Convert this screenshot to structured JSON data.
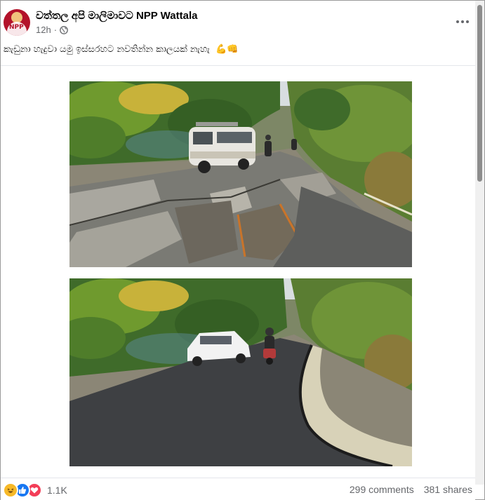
{
  "post": {
    "page_name": "වත්තල අපි මාලිමාවට NPP Wattala",
    "time": "12h",
    "separator": "·",
    "audience_icon": "globe-icon",
    "caption": "කැඩුනා හැදුවා යමු ඉස්සරහට නවතින්න කාලයක් නැහැ",
    "caption_emojis": "💪👊"
  },
  "avatar": {
    "mark": "NPP"
  },
  "photos": [
    {
      "name": "damaged-road-photo"
    },
    {
      "name": "repaired-road-photo"
    }
  ],
  "footer": {
    "reaction_icons": [
      "haha-icon",
      "like-icon",
      "love-icon"
    ],
    "reaction_count": "1.1K",
    "comments": "299 comments",
    "shares": "381 shares"
  },
  "colors": {
    "meta_text": "#65676b",
    "like": "#1877f2",
    "love": "#f33e58",
    "haha": "#f7b928",
    "avatar_bg": "#b3122a"
  }
}
